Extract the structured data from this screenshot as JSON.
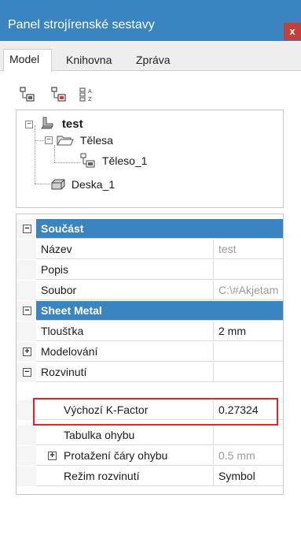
{
  "window": {
    "title": "Panel strojírenské sestavy",
    "close_label": "x"
  },
  "tabs": [
    {
      "label": "Model",
      "active": true
    },
    {
      "label": "Knihovna",
      "active": false
    },
    {
      "label": "Zpráva",
      "active": false
    }
  ],
  "toolbar": {
    "buttons": [
      "assembly-icon",
      "part-icon",
      "sort-az-icon"
    ],
    "sort_label": "A Z"
  },
  "tree": {
    "root": {
      "label": "test",
      "expanded": true
    },
    "bodies": {
      "label": "Tělesa",
      "expanded": true
    },
    "body1": {
      "label": "Těleso_1"
    },
    "plate": {
      "label": "Deska_1"
    }
  },
  "properties": {
    "cat_soucast": {
      "label": "Součást",
      "toggle": "−"
    },
    "nazev": {
      "label": "Název",
      "value": "test"
    },
    "popis": {
      "label": "Popis",
      "value": ""
    },
    "soubor": {
      "label": "Soubor",
      "value": "C:\\#Akjetam"
    },
    "cat_sheet": {
      "label": "Sheet Metal",
      "toggle": "−"
    },
    "tloustka": {
      "label": "Tloušťka",
      "value": "2 mm"
    },
    "modelovani": {
      "label": "Modelování",
      "toggle": "+"
    },
    "rozvinuti": {
      "label": "Rozvinutí",
      "toggle": "−"
    },
    "kfactor": {
      "label": "Výchozí K-Factor",
      "value": "0.27324"
    },
    "tabulka": {
      "label": "Tabulka ohybu",
      "value": ""
    },
    "protazeni": {
      "label": "Protažení čáry ohybu",
      "value": "0.5 mm",
      "toggle": "+"
    },
    "rezim": {
      "label": "Režim rozvinutí",
      "value": "Symbol"
    }
  },
  "colors": {
    "accent": "#3a85bf",
    "close": "#c3403a",
    "highlight": "#d9262b"
  }
}
